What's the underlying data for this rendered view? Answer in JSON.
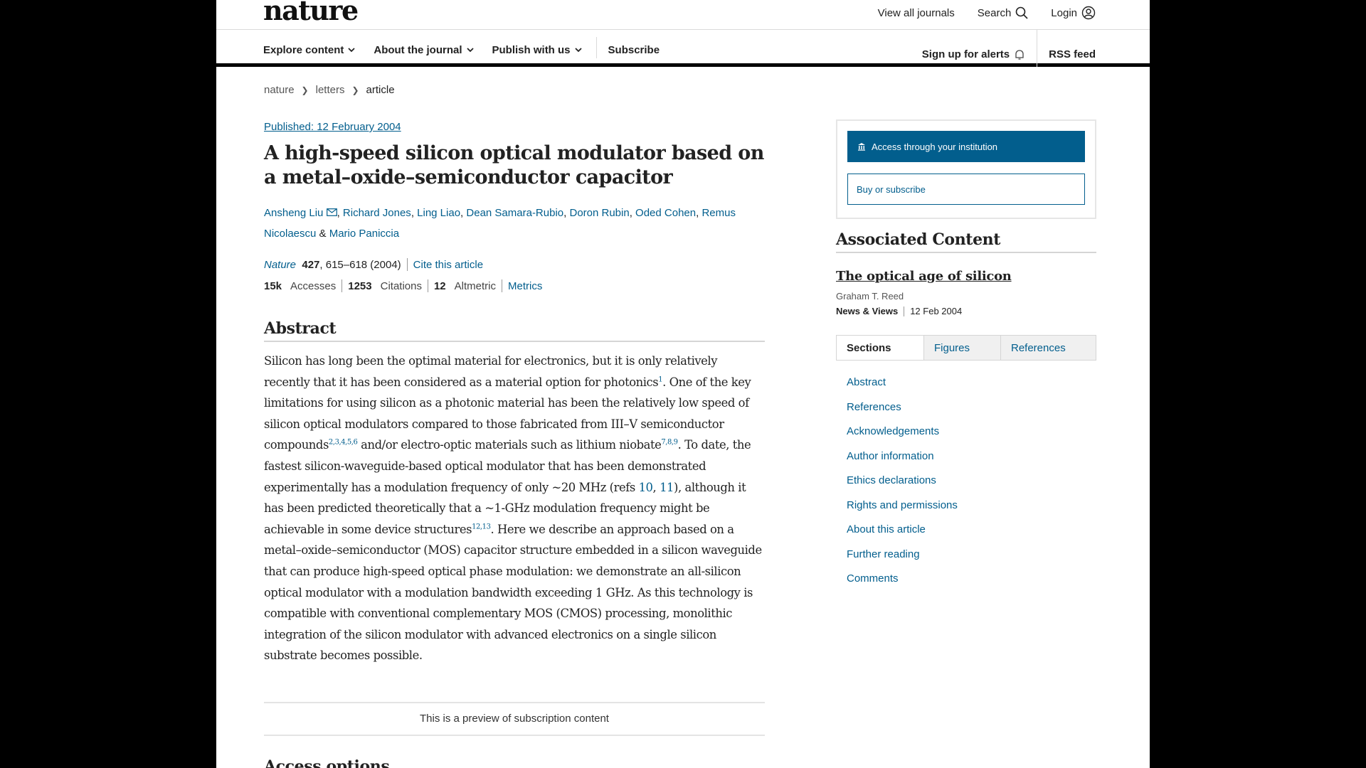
{
  "header": {
    "logo": "nature",
    "view_all": "View all journals",
    "search": "Search",
    "login": "Login"
  },
  "nav": {
    "explore": "Explore content",
    "about": "About the journal",
    "publish": "Publish with us",
    "subscribe": "Subscribe",
    "alerts": "Sign up for alerts",
    "rss": "RSS feed"
  },
  "breadcrumb": {
    "items": [
      "nature",
      "letters",
      "article"
    ]
  },
  "article": {
    "published": "Published: 12 February 2004",
    "title": "A high-speed silicon optical modulator based on a metal–oxide–semiconductor capacitor",
    "authors": [
      "Ansheng Liu",
      "Richard Jones",
      "Ling Liao",
      "Dean Samara-Rubio",
      "Doron Rubin",
      "Oded Cohen",
      "Remus Nicolaescu",
      "Mario Paniccia"
    ],
    "journal": "Nature",
    "volume": "427",
    "pages": ", 615–618 (2004)",
    "cite": "Cite this article",
    "accesses_value": "15k",
    "accesses_label": "Accesses",
    "citations_value": "1253",
    "citations_label": "Citations",
    "altmetric_value": "12",
    "altmetric_label": "Altmetric",
    "metrics": "Metrics"
  },
  "abstract": {
    "heading": "Abstract",
    "p1": "Silicon has long been the optimal material for electronics, but it is only relatively recently that it has been considered as a material option for photonics",
    "r1": "1",
    "p2": ". One of the key limitations for using silicon as a photonic material has been the relatively low speed of silicon optical modulators compared to those fabricated from III–V semiconductor compounds",
    "r2": "2,3,4,5,6",
    "p3": " and/or electro-optic materials such as lithium niobate",
    "r3": "7,8,9",
    "p4": ". To date, the fastest silicon-waveguide-based optical modulator that has been demonstrated experimentally has a modulation frequency of only ~20 MHz (refs ",
    "r4a": "10",
    "p5": ", ",
    "r4b": "11",
    "p6": "), although it has been predicted theoretically that a ~1-GHz modulation frequency might be achievable in some device structures",
    "r5": "12,13",
    "p7": ". Here we describe an approach based on a metal–oxide–semiconductor (MOS) capacitor structure embedded in a silicon waveguide that can produce high-speed optical phase modulation: we demonstrate an all-silicon optical modulator with a modulation bandwidth exceeding 1 GHz. As this technology is compatible with conventional complementary MOS (CMOS) processing, monolithic integration of the silicon modulator with advanced electronics on a single silicon substrate becomes possible."
  },
  "preview_notice": "This is a preview of subscription content",
  "access_options_heading": "Access options",
  "sidebar": {
    "institution_button": "Access through your institution",
    "buy_button": "Buy or subscribe",
    "associated_heading": "Associated Content",
    "assoc_title": "The optical age of silicon",
    "assoc_author": "Graham T. Reed",
    "assoc_type": "News & Views",
    "assoc_date": "12 Feb 2004",
    "tabs": [
      "Sections",
      "Figures",
      "References"
    ],
    "sections": [
      "Abstract",
      "References",
      "Acknowledgements",
      "Author information",
      "Ethics declarations",
      "Rights and permissions",
      "About this article",
      "Further reading",
      "Comments"
    ]
  }
}
